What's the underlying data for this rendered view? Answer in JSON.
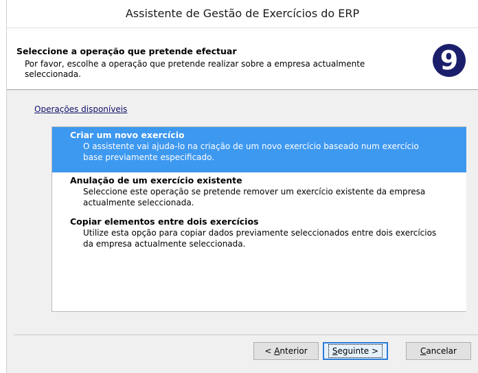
{
  "window": {
    "title": "Assistente de Gestão de Exercícios do ERP"
  },
  "header": {
    "title": "Seleccione a operação que pretende efectuar",
    "description": "Por favor, escolhe a operação que pretende realizar sobre a empresa actualmente seleccionada.",
    "logo_glyph": "9",
    "logo_color": "#1b1f6b"
  },
  "operations": {
    "label": "Operações disponíveis",
    "selected_color": "#3d98f0",
    "items": [
      {
        "title": "Criar um novo exercício",
        "description": "O assistente vai ajuda-lo na criação de um novo exercício baseado num exercício base previamente especificado.",
        "selected": true
      },
      {
        "title": "Anulação de um exercício existente",
        "description": "Seleccione este operação se pretende remover um exercício existente da empresa actualmente seleccionada.",
        "selected": false
      },
      {
        "title": "Copiar elementos entre dois exercícios",
        "description": "Utilize esta opção para copiar dados previamente seleccionados entre dois exercícios da empresa actualmente seleccionada.",
        "selected": false
      }
    ]
  },
  "buttons": {
    "back": {
      "prefix": "< ",
      "accel": "A",
      "rest": "nterior"
    },
    "next": {
      "accel": "S",
      "rest": "eguinte >"
    },
    "cancel": {
      "accel": "C",
      "rest": "ancelar"
    }
  }
}
